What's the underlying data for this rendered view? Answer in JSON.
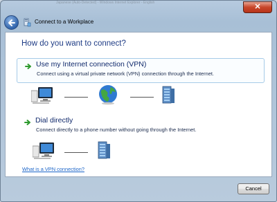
{
  "window": {
    "title": "Connect to a Workplace",
    "background_app_text": "Japanese (Auto-Detected) - Windows Internet Explorer - English"
  },
  "heading": "How do you want to connect?",
  "options": [
    {
      "title": "Use my Internet connection (VPN)",
      "description": "Connect using a virtual private network (VPN) connection through the Internet.",
      "diagram_icons": [
        "computer-icon",
        "globe-icon",
        "server-icon"
      ]
    },
    {
      "title": "Dial directly",
      "description": "Connect directly to a phone number without going through the Internet.",
      "diagram_icons": [
        "computer-icon",
        "server-icon"
      ]
    }
  ],
  "help_link": "What is a VPN connection?",
  "buttons": {
    "cancel": "Cancel",
    "close": "✕"
  },
  "colors": {
    "heading": "#1f3c85",
    "link": "#1a64c8",
    "option_hover_border": "#a6cbe8",
    "arrow_green": "#2e9a2e"
  },
  "icons": {
    "back": "back-arrow-icon",
    "window": "workplace-network-icon",
    "option_arrow": "green-arrow-icon"
  }
}
